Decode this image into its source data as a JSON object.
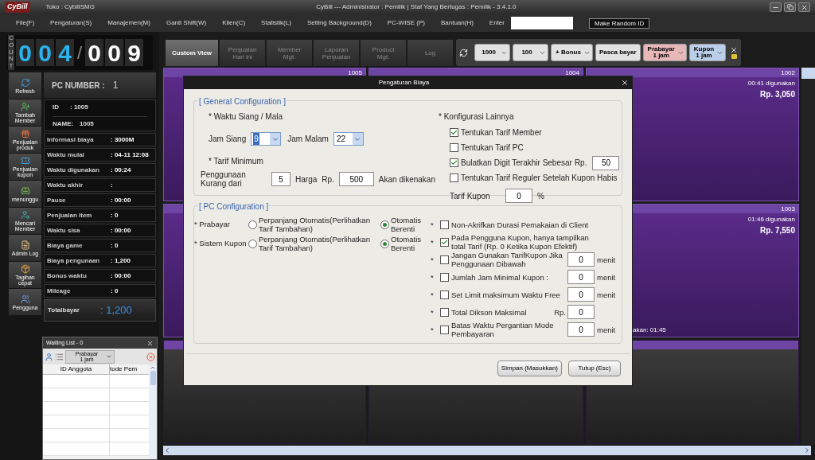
{
  "title_bar": {
    "logo": "CyBill",
    "store": "Toko : CybillSMG",
    "title": "CyBill --- Administrator : Pemilik | Staf Yang Bertugas : Pemilik - 3.4.1.0"
  },
  "menu": {
    "items": [
      "File(F)",
      "Pengaturan(S)",
      "Manajemen(M)",
      "Ganti Shift(W)",
      "Klien(C)",
      "Statistik(L)",
      "Setting Background(D)",
      "PC-WISE (P)",
      "Bantuan(H)"
    ],
    "enter_label": "Enter",
    "random_button": "Make Random ID"
  },
  "counter": {
    "label": "COUNT",
    "current": [
      "0",
      "0",
      "4"
    ],
    "separator": "/",
    "total": [
      "0",
      "0",
      "9"
    ]
  },
  "side_buttons": [
    {
      "kind": "refresh",
      "label": "Refresh"
    },
    {
      "kind": "add-member",
      "label": "Tambah Member"
    },
    {
      "kind": "product",
      "label": "Penjualan produk"
    },
    {
      "kind": "coupon",
      "label": "Penjualan kupon"
    },
    {
      "kind": "waiting",
      "label": "menunggu"
    },
    {
      "kind": "search-member",
      "label": "Mencari Member"
    },
    {
      "kind": "log",
      "label": "Admin Log"
    },
    {
      "kind": "bill",
      "label": "Tagihan cepat"
    },
    {
      "kind": "users",
      "label": "Pengguna"
    }
  ],
  "pc_info": {
    "heading": "PC NUMBER :",
    "number": "1",
    "id_label": "ID",
    "id_value": ":   1005",
    "name_label": "NAME:",
    "name_value": "1005",
    "rows": [
      {
        "label": "Informasi biaya",
        "value": ": 3000M"
      },
      {
        "label": "Waktu mulai",
        "value": ": 04-11 12:08"
      },
      {
        "label": "Waktu digunakan",
        "value": ": 00:24"
      },
      {
        "label": "Waktu akhir",
        "value": ":"
      },
      {
        "label": "Pause",
        "value": ": 00:00"
      },
      {
        "label": "Penjualan item",
        "value": ": 0"
      },
      {
        "label": "Waktu sisa",
        "value": ": 00:00"
      },
      {
        "label": "Biaya game",
        "value": ": 0"
      },
      {
        "label": "Biaya pengunaan",
        "value": ": 1,200"
      },
      {
        "label": "Bonus waktu",
        "value": ": 00:00"
      },
      {
        "label": "Mileage",
        "value": ": 0"
      }
    ],
    "total_label": "Totalbayar",
    "total_value": ": 1,200"
  },
  "tabs": [
    {
      "label": "Custom View",
      "selected": true
    },
    {
      "label": "Penjualan\nHari ini",
      "selected": false
    },
    {
      "label": "Member\nMgt.",
      "selected": false
    },
    {
      "label": "Laporan\nPenjualan",
      "selected": false
    },
    {
      "label": "Product\nMgt.",
      "selected": false
    },
    {
      "label": "Log",
      "selected": false
    }
  ],
  "toolbar": [
    {
      "kind": "dropdown",
      "label": "1000",
      "color": "#e2e2e2"
    },
    {
      "kind": "dropdown",
      "label": "100",
      "color": "#e2e2e2"
    },
    {
      "kind": "dropdown",
      "label": "+ Bonus",
      "color": "#e2e2e2"
    },
    {
      "kind": "button",
      "label": "Pasca bayar",
      "color": "#e2e2e2"
    },
    {
      "kind": "dropdown",
      "label": "Prabayar\n1 jam",
      "color": "#e8b8b8"
    },
    {
      "kind": "dropdown",
      "label": "Kupon\n1 jam",
      "color": "#bccfe8"
    }
  ],
  "tiles": [
    {
      "in_use": true,
      "number": "1005"
    },
    {
      "in_use": true,
      "number": "1004"
    },
    {
      "in_use": true,
      "number": "1002",
      "usage": "00:41 digunakan",
      "price": "Rp. 3,050"
    },
    {
      "in_use": true
    },
    {
      "in_use": true,
      "number": "1003",
      "usage": "01:46 digunakan",
      "price": "Rp. 7,550",
      "note": "akan: 01:45"
    },
    {
      "in_use": false
    },
    {
      "in_use": false
    },
    {
      "in_use": false
    }
  ],
  "waiting_list": {
    "title": "Waiting List - 0",
    "filter": "Prabayar\n1 jam",
    "columns": [
      "ID Anggota",
      "tode Pem"
    ]
  },
  "dialog": {
    "title": "Pengaturan Biaya",
    "general": {
      "legend": "[ General Configuration ]",
      "day_night": {
        "heading": "* Waktu Siang / Mala",
        "day_label": "Jam Siang",
        "day_value": "9",
        "night_label": "Jam Malam",
        "night_value": "22"
      },
      "minimum": {
        "heading": "* Tarif Minimum",
        "label": "Penggunaan Kurang dari",
        "minutes": "5",
        "price_label": "Harga",
        "currency": "Rp.",
        "price": "500",
        "suffix": "Akan dikenakan"
      },
      "other": {
        "heading": "* Konfigurasi Lainnya",
        "options": [
          {
            "label": "Tentukan Tarif Member",
            "checked": true
          },
          {
            "label": "Tentukan Tarif PC",
            "checked": false
          },
          {
            "label": "Bulatkan Digit Terakhir Sebesar",
            "checked": true,
            "prefix": "Rp.",
            "value": "50"
          },
          {
            "label": "Tentukan Tarif Reguler Setelah Kupon Habis",
            "checked": false
          }
        ],
        "coupon_label": "Tarif Kupon",
        "coupon_value": "0",
        "coupon_unit": "%"
      }
    },
    "pc": {
      "legend": "[ PC Configuration ]",
      "modes": [
        {
          "label": "* Prabayar",
          "options": [
            {
              "label": "Perpanjang Otomatis(Perlihatkan Tarif Tambahan)",
              "selected": false
            },
            {
              "label": "Otomatis Berenti",
              "selected": true
            }
          ]
        },
        {
          "label": "* Sistem Kupon",
          "options": [
            {
              "label": "Perpanjang Otomatis(Perlihatkan Tarif Tambahan)",
              "selected": false
            },
            {
              "label": "Otomatis Berenti",
              "selected": true
            }
          ]
        }
      ],
      "options": [
        {
          "bullet": "*",
          "label": "Non-Akrifkan Durasi Pemakaian di Client",
          "checked": false
        },
        {
          "bullet": "*",
          "label": "Pada Pengguna Kupon, hanya tampilkan total Tarif (Rp. 0 Ketika Kupon Efektif)",
          "checked": true
        },
        {
          "bullet": "*",
          "label": "Jangan Gunakan TarifKupon Jika Penggunaan Dibawah",
          "checked": false,
          "value": "0",
          "unit": "menit"
        },
        {
          "bullet": "*",
          "label": "Jumlah Jam Minimal Kupon :",
          "checked": false,
          "value": "0",
          "unit": "menit"
        },
        {
          "bullet": "*",
          "label": "Set Limit maksimum Waktu Free",
          "checked": false,
          "value": "0",
          "unit": "menit"
        },
        {
          "bullet": "*",
          "label": "Total Dikson Maksimal",
          "checked": false,
          "prefix": "Rp.",
          "value": "0"
        },
        {
          "bullet": "*",
          "label": "Batas Waktu Pergantian Mode Pembayaran",
          "checked": false,
          "value": "0",
          "unit": "menit"
        }
      ]
    },
    "buttons": [
      "Simpan (Masukkan)",
      "Tutup (Esc)"
    ]
  }
}
